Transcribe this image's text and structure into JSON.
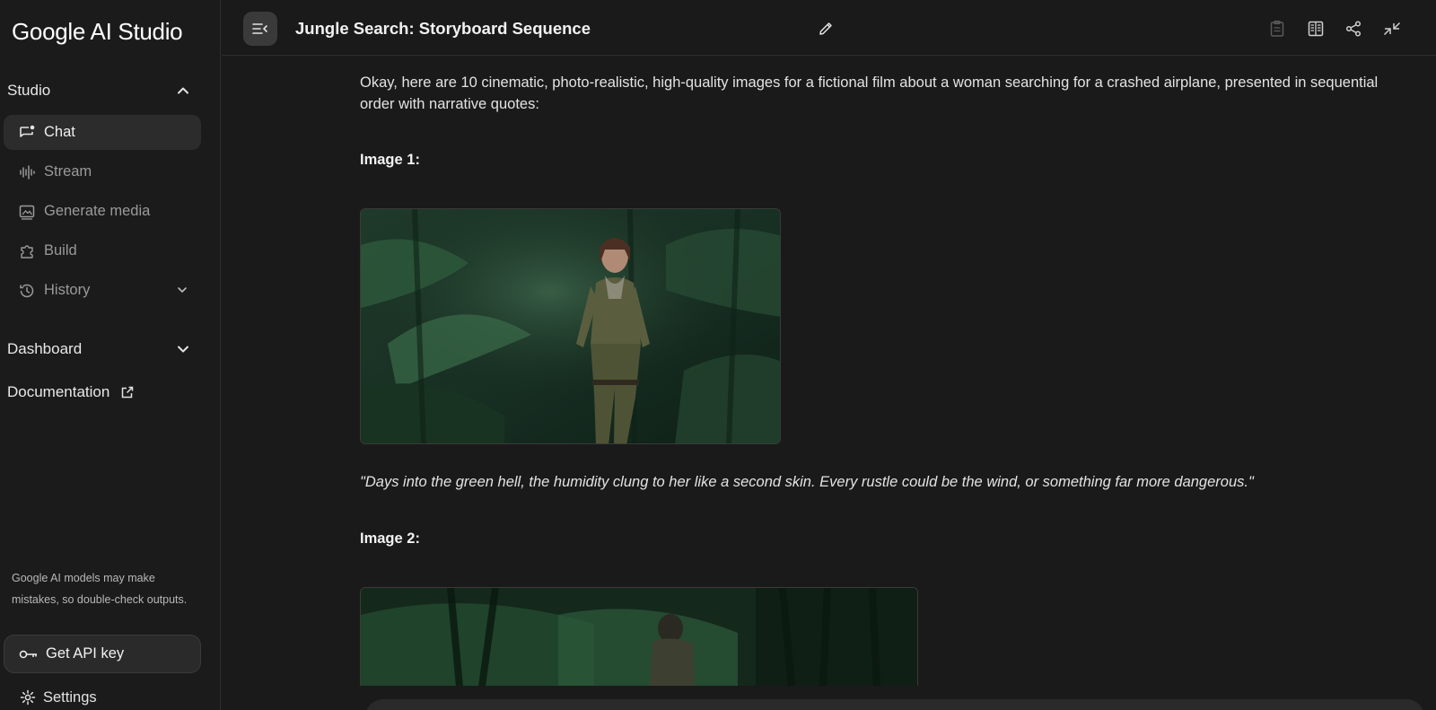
{
  "app": {
    "logo": "Google AI Studio"
  },
  "sidebar": {
    "studio_label": "Studio",
    "items": [
      {
        "label": "Chat",
        "icon": "chat-icon"
      },
      {
        "label": "Stream",
        "icon": "waveform-icon"
      },
      {
        "label": "Generate media",
        "icon": "image-icon"
      },
      {
        "label": "Build",
        "icon": "puzzle-icon"
      },
      {
        "label": "History",
        "icon": "history-icon"
      }
    ],
    "dashboard_label": "Dashboard",
    "documentation_label": "Documentation",
    "disclaimer": "Google AI models may make mistakes, so double-check outputs.",
    "api_key_label": "Get API key",
    "settings_label": "Settings"
  },
  "header": {
    "title": "Jungle Search: Storyboard Sequence",
    "icons": [
      "clipboard-icon",
      "compare-icon",
      "share-icon",
      "collapse-icon"
    ]
  },
  "chat": {
    "intro": "Okay, here are 10 cinematic, photo-realistic, high-quality images for a fictional film about a woman searching for a crashed airplane, presented in sequential order with narrative quotes:",
    "image1_label": "Image 1:",
    "image1_quote": "\"Days into the green hell, the humidity clung to her like a second skin. Every rustle could be the wind, or something far more dangerous.\"",
    "image2_label": "Image 2:"
  },
  "colors": {
    "background": "#1a1a1a",
    "sidebar_active": "#2c2c2c",
    "text": "#e3e3e3",
    "muted": "#9a9a9a"
  }
}
